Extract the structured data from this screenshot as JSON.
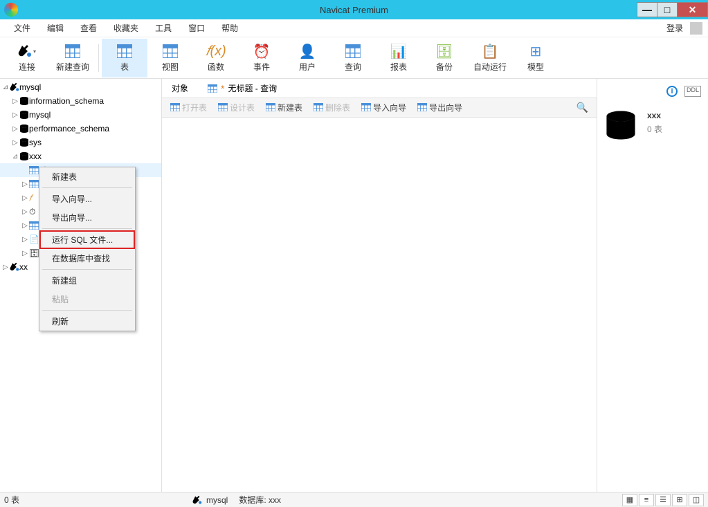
{
  "app": {
    "title": "Navicat Premium"
  },
  "window_controls": {
    "min": "—",
    "max": "□",
    "close": "✕"
  },
  "menu": {
    "file": "文件",
    "edit": "编辑",
    "view": "查看",
    "favorites": "收藏夹",
    "tools": "工具",
    "window": "窗口",
    "help": "帮助",
    "login": "登录"
  },
  "toolbar": {
    "connect": "连接",
    "new_query": "新建查询",
    "table": "表",
    "view": "视图",
    "function": "函数",
    "event": "事件",
    "user": "用户",
    "query": "查询",
    "report": "报表",
    "backup": "备份",
    "auto_run": "自动运行",
    "model": "模型",
    "fx_glyph": "𝑓(x)"
  },
  "tree": {
    "conn1": "mysql",
    "dbs": {
      "info_schema": "information_schema",
      "mysql": "mysql",
      "perf_schema": "performance_schema",
      "sys": "sys",
      "xxx": "xxx"
    },
    "table_node": "表",
    "conn2": "xx"
  },
  "context_menu": {
    "new_table": "新建表",
    "import_wizard": "导入向导...",
    "export_wizard": "导出向导...",
    "run_sql": "运行 SQL 文件...",
    "find_in_db": "在数据库中查找",
    "new_group": "新建组",
    "paste": "粘贴",
    "refresh": "刷新"
  },
  "tabs": {
    "objects": "对象",
    "untitled_query": "无标题 - 查询",
    "dirty_marker": "*"
  },
  "actionbar": {
    "open_table": "打开表",
    "design_table": "设计表",
    "new_table": "新建表",
    "delete_table": "删除表",
    "import_wizard": "导入向导",
    "export_wizard": "导出向导"
  },
  "right": {
    "db_name": "xxx",
    "table_count": "0 表"
  },
  "status": {
    "left": "0 表",
    "conn": "mysql",
    "db_label": "数据库: xxx"
  }
}
